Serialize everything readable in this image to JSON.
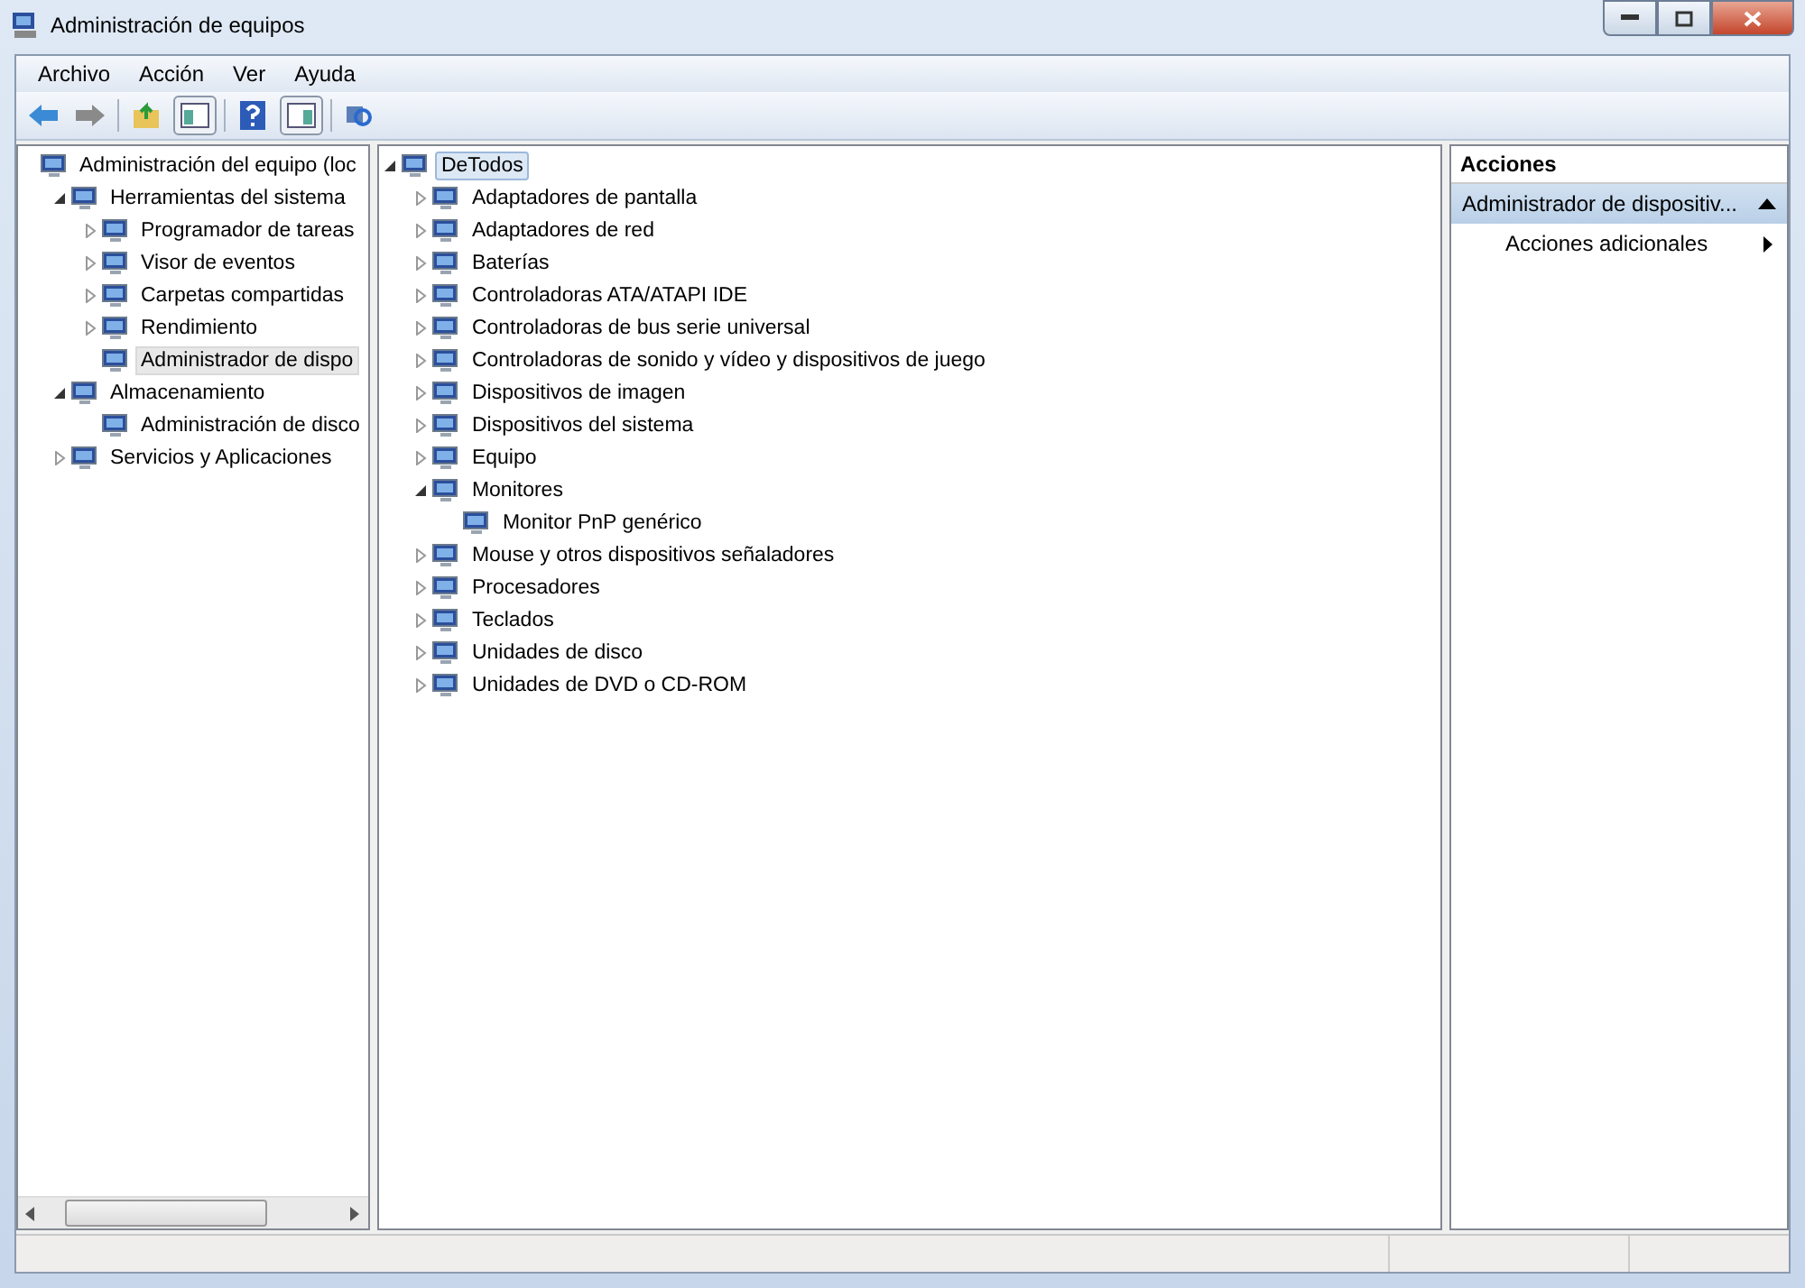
{
  "window": {
    "title": "Administración de equipos"
  },
  "menu": [
    "Archivo",
    "Acción",
    "Ver",
    "Ayuda"
  ],
  "left_tree": [
    {
      "label": "Administración del equipo (loc",
      "selected": false,
      "children": [
        {
          "label": "Herramientas del sistema",
          "expanded": true,
          "selected": false,
          "children": [
            {
              "label": "Programador de tareas",
              "expanded": false,
              "selected": false
            },
            {
              "label": "Visor de eventos",
              "expanded": false,
              "selected": false
            },
            {
              "label": "Carpetas compartidas",
              "expanded": false,
              "selected": false
            },
            {
              "label": "Rendimiento",
              "expanded": false,
              "selected": false
            },
            {
              "label": "Administrador de dispo",
              "selected": true
            }
          ]
        },
        {
          "label": "Almacenamiento",
          "expanded": true,
          "selected": false,
          "children": [
            {
              "label": "Administración de disco",
              "selected": false
            }
          ]
        },
        {
          "label": "Servicios y Aplicaciones",
          "expanded": false,
          "selected": false
        }
      ]
    }
  ],
  "device_tree": [
    {
      "label": "DeTodos",
      "expanded": true,
      "selected": true,
      "children": [
        {
          "label": "Adaptadores de pantalla",
          "expanded": false,
          "selected": false
        },
        {
          "label": "Adaptadores de red",
          "expanded": false,
          "selected": false
        },
        {
          "label": "Baterías",
          "expanded": false,
          "selected": false
        },
        {
          "label": "Controladoras ATA/ATAPI IDE",
          "expanded": false,
          "selected": false
        },
        {
          "label": "Controladoras de bus serie universal",
          "expanded": false,
          "selected": false
        },
        {
          "label": "Controladoras de sonido y vídeo y dispositivos de juego",
          "expanded": false,
          "selected": false
        },
        {
          "label": "Dispositivos de imagen",
          "expanded": false,
          "selected": false
        },
        {
          "label": "Dispositivos del sistema",
          "expanded": false,
          "selected": false
        },
        {
          "label": "Equipo",
          "expanded": false,
          "selected": false
        },
        {
          "label": "Monitores",
          "expanded": true,
          "selected": false,
          "children": [
            {
              "label": "Monitor PnP genérico",
              "selected": false
            }
          ]
        },
        {
          "label": "Mouse y otros dispositivos señaladores",
          "expanded": false,
          "selected": false
        },
        {
          "label": "Procesadores",
          "expanded": false,
          "selected": false
        },
        {
          "label": "Teclados",
          "expanded": false,
          "selected": false
        },
        {
          "label": "Unidades de disco",
          "expanded": false,
          "selected": false
        },
        {
          "label": "Unidades de DVD o CD-ROM",
          "expanded": false,
          "selected": false
        }
      ]
    }
  ],
  "actions": {
    "title": "Acciones",
    "section": {
      "label": "Administrador de dispositiv...",
      "expanded": true
    },
    "items": [
      "Acciones adicionales"
    ]
  }
}
